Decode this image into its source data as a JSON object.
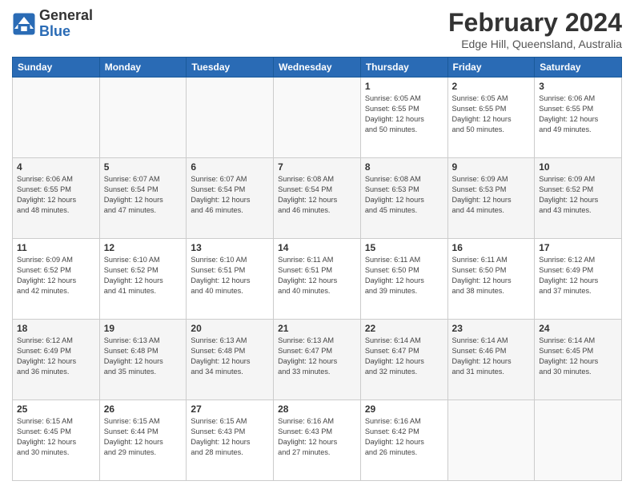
{
  "header": {
    "logo_general": "General",
    "logo_blue": "Blue",
    "month_title": "February 2024",
    "location": "Edge Hill, Queensland, Australia"
  },
  "days_of_week": [
    "Sunday",
    "Monday",
    "Tuesday",
    "Wednesday",
    "Thursday",
    "Friday",
    "Saturday"
  ],
  "weeks": [
    [
      {
        "day": "",
        "info": ""
      },
      {
        "day": "",
        "info": ""
      },
      {
        "day": "",
        "info": ""
      },
      {
        "day": "",
        "info": ""
      },
      {
        "day": "1",
        "info": "Sunrise: 6:05 AM\nSunset: 6:55 PM\nDaylight: 12 hours\nand 50 minutes."
      },
      {
        "day": "2",
        "info": "Sunrise: 6:05 AM\nSunset: 6:55 PM\nDaylight: 12 hours\nand 50 minutes."
      },
      {
        "day": "3",
        "info": "Sunrise: 6:06 AM\nSunset: 6:55 PM\nDaylight: 12 hours\nand 49 minutes."
      }
    ],
    [
      {
        "day": "4",
        "info": "Sunrise: 6:06 AM\nSunset: 6:55 PM\nDaylight: 12 hours\nand 48 minutes."
      },
      {
        "day": "5",
        "info": "Sunrise: 6:07 AM\nSunset: 6:54 PM\nDaylight: 12 hours\nand 47 minutes."
      },
      {
        "day": "6",
        "info": "Sunrise: 6:07 AM\nSunset: 6:54 PM\nDaylight: 12 hours\nand 46 minutes."
      },
      {
        "day": "7",
        "info": "Sunrise: 6:08 AM\nSunset: 6:54 PM\nDaylight: 12 hours\nand 46 minutes."
      },
      {
        "day": "8",
        "info": "Sunrise: 6:08 AM\nSunset: 6:53 PM\nDaylight: 12 hours\nand 45 minutes."
      },
      {
        "day": "9",
        "info": "Sunrise: 6:09 AM\nSunset: 6:53 PM\nDaylight: 12 hours\nand 44 minutes."
      },
      {
        "day": "10",
        "info": "Sunrise: 6:09 AM\nSunset: 6:52 PM\nDaylight: 12 hours\nand 43 minutes."
      }
    ],
    [
      {
        "day": "11",
        "info": "Sunrise: 6:09 AM\nSunset: 6:52 PM\nDaylight: 12 hours\nand 42 minutes."
      },
      {
        "day": "12",
        "info": "Sunrise: 6:10 AM\nSunset: 6:52 PM\nDaylight: 12 hours\nand 41 minutes."
      },
      {
        "day": "13",
        "info": "Sunrise: 6:10 AM\nSunset: 6:51 PM\nDaylight: 12 hours\nand 40 minutes."
      },
      {
        "day": "14",
        "info": "Sunrise: 6:11 AM\nSunset: 6:51 PM\nDaylight: 12 hours\nand 40 minutes."
      },
      {
        "day": "15",
        "info": "Sunrise: 6:11 AM\nSunset: 6:50 PM\nDaylight: 12 hours\nand 39 minutes."
      },
      {
        "day": "16",
        "info": "Sunrise: 6:11 AM\nSunset: 6:50 PM\nDaylight: 12 hours\nand 38 minutes."
      },
      {
        "day": "17",
        "info": "Sunrise: 6:12 AM\nSunset: 6:49 PM\nDaylight: 12 hours\nand 37 minutes."
      }
    ],
    [
      {
        "day": "18",
        "info": "Sunrise: 6:12 AM\nSunset: 6:49 PM\nDaylight: 12 hours\nand 36 minutes."
      },
      {
        "day": "19",
        "info": "Sunrise: 6:13 AM\nSunset: 6:48 PM\nDaylight: 12 hours\nand 35 minutes."
      },
      {
        "day": "20",
        "info": "Sunrise: 6:13 AM\nSunset: 6:48 PM\nDaylight: 12 hours\nand 34 minutes."
      },
      {
        "day": "21",
        "info": "Sunrise: 6:13 AM\nSunset: 6:47 PM\nDaylight: 12 hours\nand 33 minutes."
      },
      {
        "day": "22",
        "info": "Sunrise: 6:14 AM\nSunset: 6:47 PM\nDaylight: 12 hours\nand 32 minutes."
      },
      {
        "day": "23",
        "info": "Sunrise: 6:14 AM\nSunset: 6:46 PM\nDaylight: 12 hours\nand 31 minutes."
      },
      {
        "day": "24",
        "info": "Sunrise: 6:14 AM\nSunset: 6:45 PM\nDaylight: 12 hours\nand 30 minutes."
      }
    ],
    [
      {
        "day": "25",
        "info": "Sunrise: 6:15 AM\nSunset: 6:45 PM\nDaylight: 12 hours\nand 30 minutes."
      },
      {
        "day": "26",
        "info": "Sunrise: 6:15 AM\nSunset: 6:44 PM\nDaylight: 12 hours\nand 29 minutes."
      },
      {
        "day": "27",
        "info": "Sunrise: 6:15 AM\nSunset: 6:43 PM\nDaylight: 12 hours\nand 28 minutes."
      },
      {
        "day": "28",
        "info": "Sunrise: 6:16 AM\nSunset: 6:43 PM\nDaylight: 12 hours\nand 27 minutes."
      },
      {
        "day": "29",
        "info": "Sunrise: 6:16 AM\nSunset: 6:42 PM\nDaylight: 12 hours\nand 26 minutes."
      },
      {
        "day": "",
        "info": ""
      },
      {
        "day": "",
        "info": ""
      }
    ]
  ]
}
